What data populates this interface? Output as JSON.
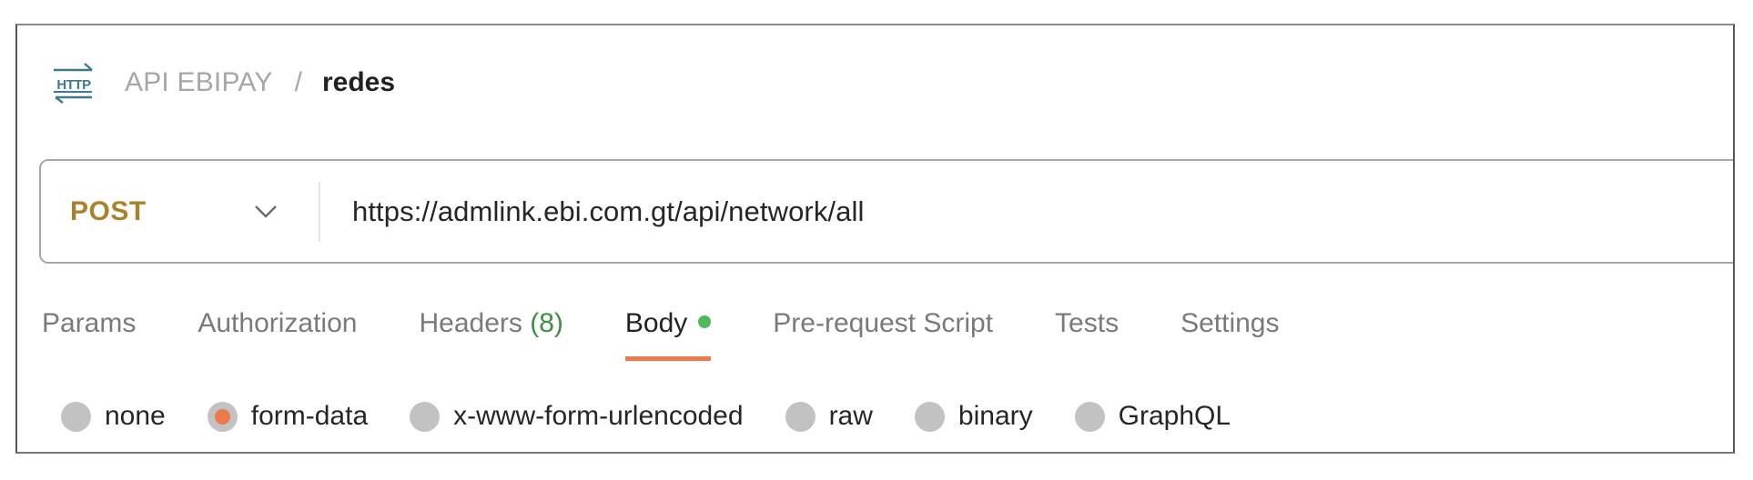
{
  "breadcrumb": {
    "icon": "http-icon",
    "parent": "API EBIPAY",
    "separator": "/",
    "current": "redes"
  },
  "request": {
    "method": "POST",
    "method_color": "#a8832e",
    "url": "https://admlink.ebi.com.gt/api/network/all"
  },
  "tabs": [
    {
      "label": "Params",
      "active": false
    },
    {
      "label": "Authorization",
      "active": false
    },
    {
      "label": "Headers",
      "count": "(8)",
      "active": false
    },
    {
      "label": "Body",
      "active": true,
      "indicator": "green-dot"
    },
    {
      "label": "Pre-request Script",
      "active": false
    },
    {
      "label": "Tests",
      "active": false
    },
    {
      "label": "Settings",
      "active": false
    }
  ],
  "body_types": [
    {
      "label": "none",
      "checked": false
    },
    {
      "label": "form-data",
      "checked": true
    },
    {
      "label": "x-www-form-urlencoded",
      "checked": false
    },
    {
      "label": "raw",
      "checked": false
    },
    {
      "label": "binary",
      "checked": false
    },
    {
      "label": "GraphQL",
      "checked": false
    }
  ],
  "colors": {
    "accent": "#ec7a4a",
    "success": "#4fb85a",
    "count": "#3f8f45",
    "http_icon": "#3d7a8a"
  }
}
